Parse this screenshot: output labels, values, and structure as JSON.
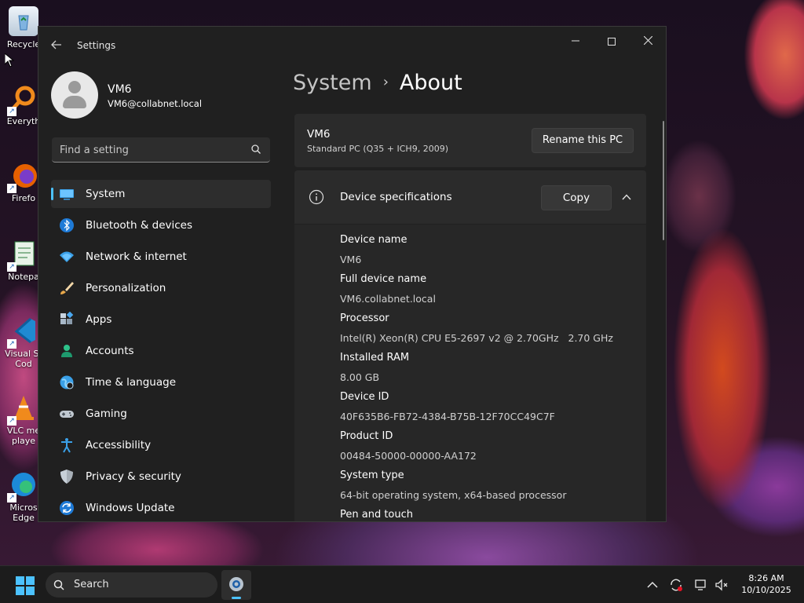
{
  "desktop": {
    "icons": [
      {
        "label": "Recycle",
        "name": "recycle-bin"
      },
      {
        "label": "Everyth",
        "name": "everything"
      },
      {
        "label": "Firefo",
        "name": "firefox"
      },
      {
        "label": "Notepa",
        "name": "notepad"
      },
      {
        "label": "Visual St",
        "label2": "Cod",
        "name": "vscode"
      },
      {
        "label": "VLC me",
        "label2": "playe",
        "name": "vlc"
      },
      {
        "label": "Micros",
        "label2": "Edge",
        "name": "edge"
      }
    ]
  },
  "window": {
    "title": "Settings",
    "controls": {
      "minimize": "—",
      "close": "✕"
    }
  },
  "user": {
    "name": "VM6",
    "email": "VM6@collabnet.local"
  },
  "search": {
    "placeholder": "Find a setting"
  },
  "nav": {
    "items": [
      {
        "label": "System",
        "icon": "system-icon",
        "active": true
      },
      {
        "label": "Bluetooth & devices",
        "icon": "bluetooth-icon"
      },
      {
        "label": "Network & internet",
        "icon": "wifi-icon"
      },
      {
        "label": "Personalization",
        "icon": "brush-icon"
      },
      {
        "label": "Apps",
        "icon": "apps-icon"
      },
      {
        "label": "Accounts",
        "icon": "accounts-icon"
      },
      {
        "label": "Time & language",
        "icon": "globe-icon"
      },
      {
        "label": "Gaming",
        "icon": "gamepad-icon"
      },
      {
        "label": "Accessibility",
        "icon": "accessibility-icon"
      },
      {
        "label": "Privacy & security",
        "icon": "shield-icon"
      },
      {
        "label": "Windows Update",
        "icon": "update-icon"
      }
    ]
  },
  "breadcrumb": {
    "parent": "System",
    "separator": "›",
    "current": "About"
  },
  "pc": {
    "name": "VM6",
    "model": "Standard PC (Q35 + ICH9, 2009)",
    "rename_label": "Rename this PC"
  },
  "specs": {
    "title": "Device specifications",
    "copy_label": "Copy",
    "rows": [
      {
        "label": "Device name",
        "value": "VM6"
      },
      {
        "label": "Full device name",
        "value": "VM6.collabnet.local"
      },
      {
        "label": "Processor",
        "value": "Intel(R) Xeon(R) CPU E5-2697 v2 @ 2.70GHz   2.70 GHz"
      },
      {
        "label": "Installed RAM",
        "value": "8.00 GB"
      },
      {
        "label": "Device ID",
        "value": "40F635B6-FB72-4384-B75B-12F70CC49C7F"
      },
      {
        "label": "Product ID",
        "value": "00484-50000-00000-AA172"
      },
      {
        "label": "System type",
        "value": "64-bit operating system, x64-based processor"
      },
      {
        "label": "Pen and touch",
        "value": ""
      }
    ]
  },
  "taskbar": {
    "search_label": "Search",
    "time": "8:26 AM",
    "date": "10/10/2025"
  },
  "colors": {
    "accent": "#4cc2ff",
    "window_bg": "#202020",
    "card_bg": "#2b2b2b"
  }
}
